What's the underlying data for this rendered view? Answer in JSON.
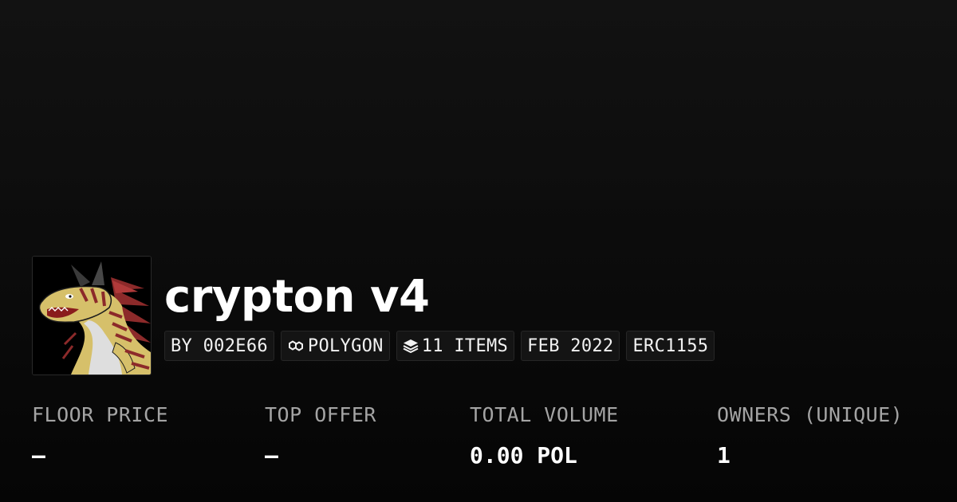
{
  "collection": {
    "title": "crypton v4",
    "avatar_icon": "dragon-avatar-image",
    "badges": {
      "creator": "BY 002E66",
      "chain": "POLYGON",
      "chain_icon": "polygon-icon",
      "items": "11 ITEMS",
      "items_icon": "layers-icon",
      "date": "FEB 2022",
      "standard": "ERC1155"
    }
  },
  "stats": {
    "floor_price": {
      "label": "FLOOR PRICE",
      "value": "–"
    },
    "top_offer": {
      "label": "TOP OFFER",
      "value": "–"
    },
    "total_volume": {
      "label": "TOTAL VOLUME",
      "value": "0.00 POL"
    },
    "owners": {
      "label": "OWNERS (UNIQUE)",
      "value": "1"
    }
  },
  "colors": {
    "background": "#0b0b0b",
    "badge_background": "#141414",
    "label": "#a4a4a4",
    "value": "#ffffff"
  }
}
